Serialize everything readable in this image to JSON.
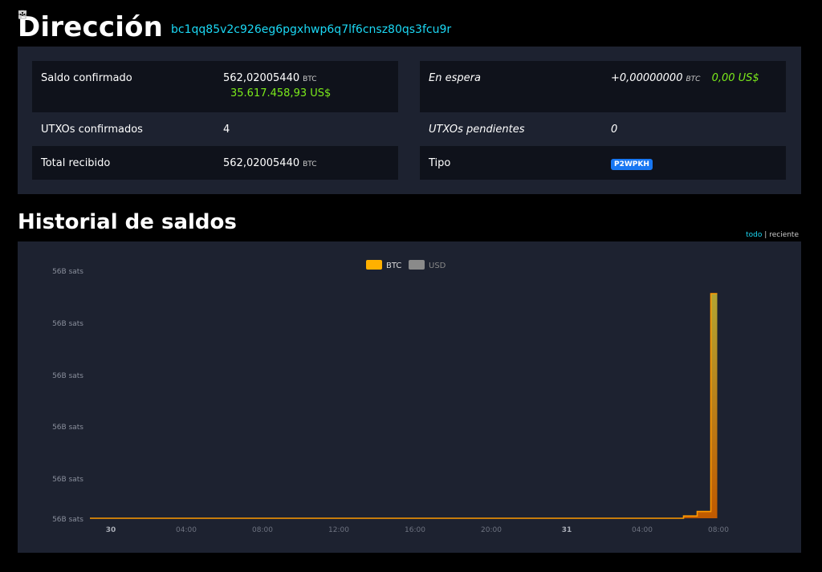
{
  "header": {
    "title": "Dirección",
    "address": "bc1qq85v2c926eg6pgxhwp6q7lf6cnsz80qs3fcu9r"
  },
  "summary": {
    "left": [
      {
        "label": "Saldo confirmado",
        "value": "562,02005440",
        "unit": "BTC",
        "fiat": "35.617.458,93 US$"
      },
      {
        "label": "UTXOs confirmados",
        "value": "4"
      },
      {
        "label": "Total recibido",
        "value": "562,02005440",
        "unit": "BTC"
      }
    ],
    "right": [
      {
        "label": "En espera",
        "value": "+0,00000000",
        "unit": "BTC",
        "fiat": "0,00 US$"
      },
      {
        "label": "UTXOs pendientes",
        "value": "0"
      },
      {
        "label": "Tipo",
        "badge": "P2WPKH"
      }
    ]
  },
  "history": {
    "title": "Historial de saldos",
    "toggle": {
      "all": "todo",
      "sep": "|",
      "recent": "reciente"
    }
  },
  "chart_data": {
    "type": "area",
    "legend": [
      {
        "name": "BTC",
        "color": "#ffb000"
      },
      {
        "name": "USD",
        "color": "#8a8a8a"
      }
    ],
    "y_tick_labels": [
      "56B sats",
      "56B sats",
      "56B sats",
      "56B sats",
      "56B sats",
      "56B sats"
    ],
    "x_tick_labels": [
      "30",
      "04:00",
      "08:00",
      "12:00",
      "16:00",
      "20:00",
      "31",
      "04:00",
      "08:00"
    ],
    "series": [
      {
        "name": "BTC",
        "x_index": [
          0,
          0.86,
          0.87,
          0.88,
          0.89,
          0.9,
          0.91
        ],
        "levels": [
          0.0,
          0.0,
          0.01,
          0.01,
          0.03,
          0.03,
          1.0
        ]
      }
    ]
  }
}
